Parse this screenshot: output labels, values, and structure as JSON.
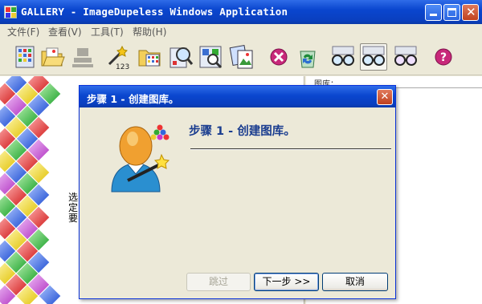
{
  "app": {
    "title": "GALLERY - ImageDupeless Windows Application"
  },
  "menu": {
    "items": [
      {
        "label": "文件(F)"
      },
      {
        "label": "查看(V)"
      },
      {
        "label": "工具(T)"
      },
      {
        "label": "帮助(H)"
      }
    ]
  },
  "toolbar": {
    "tools": [
      {
        "icon": "gallery-grid-icon"
      },
      {
        "icon": "open-folder-icon"
      },
      {
        "icon": "stamp-disabled-icon"
      },
      {
        "icon": "wand-numbering-icon"
      },
      {
        "icon": "folder-scan-icon"
      },
      {
        "icon": "magnifier-image-icon"
      },
      {
        "icon": "image-search-icon"
      },
      {
        "icon": "compare-images-icon"
      },
      {
        "icon": "stop-delete-icon"
      },
      {
        "icon": "recycle-icon"
      },
      {
        "icon": "glasses-view-icon"
      },
      {
        "icon": "glasses-compare-icon"
      },
      {
        "icon": "glasses-dual-icon"
      },
      {
        "icon": "help-icon"
      }
    ]
  },
  "right_pane": {
    "header": "图库："
  },
  "background": {
    "partial_text": "选定要"
  },
  "dialog": {
    "title": "步骤 1 - 创建图库。",
    "heading": "步骤 1 - 创建图库。",
    "buttons": {
      "skip": "跳过",
      "next": "下一步 >>",
      "cancel": "取消"
    }
  },
  "colors": {
    "title_bar": "#0a46cf",
    "heading_text": "#1a3d8f",
    "close_button": "#c0411f"
  }
}
